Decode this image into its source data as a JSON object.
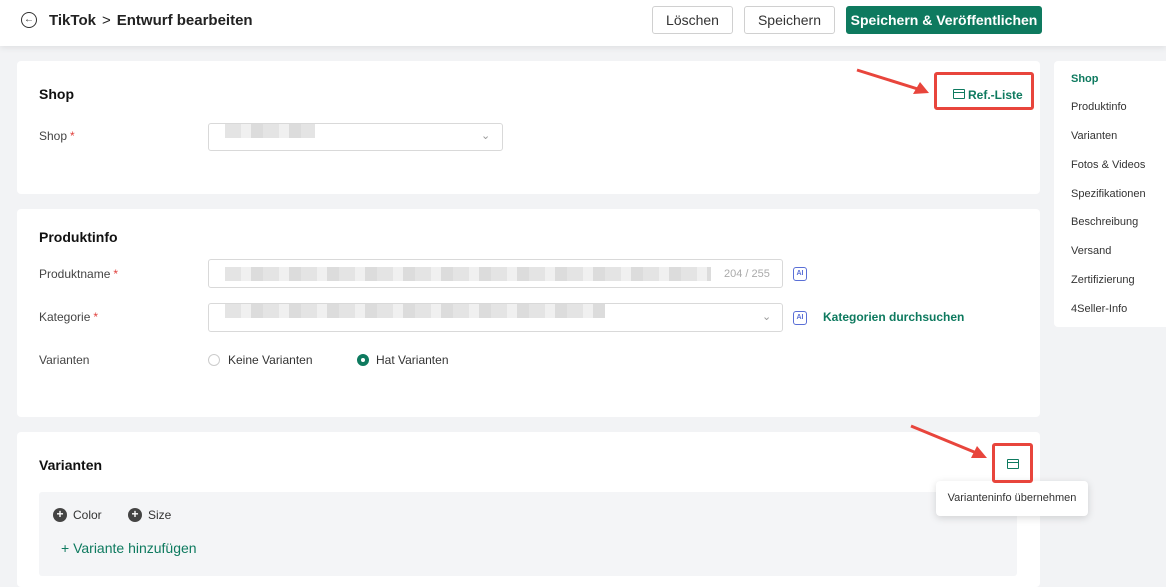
{
  "header": {
    "back_icon": "arrow-left-circle-icon",
    "crumb_root": "TikTok",
    "crumb_sep": ">",
    "crumb_current": "Entwurf bearbeiten",
    "delete_label": "Löschen",
    "save_label": "Speichern",
    "publish_label": "Speichern & Veröffentlichen"
  },
  "shop_section": {
    "title": "Shop",
    "ref_list_label": "Ref.-Liste",
    "shop_label": "Shop",
    "required_mark": "*"
  },
  "product_section": {
    "title": "Produktinfo",
    "name_label": "Produktname",
    "name_counter": "204 / 255",
    "category_label": "Kategorie",
    "search_categories_label": "Kategorien durchsuchen",
    "variants_label": "Varianten",
    "ai_badge": "AI",
    "no_variants_label": "Keine Varianten",
    "has_variants_label": "Hat Varianten",
    "selected_variant_option": "Hat Varianten"
  },
  "variants_section": {
    "title": "Varianten",
    "attr_color": "Color",
    "attr_size": "Size",
    "add_variant_label": "Variante hinzufügen",
    "tooltip": "Varianteninfo übernehmen"
  },
  "sidenav": {
    "items": [
      "Shop",
      "Produktinfo",
      "Varianten",
      "Fotos & Videos",
      "Spezifikationen",
      "Beschreibung",
      "Versand",
      "Zertifizierung",
      "4Seller-Info"
    ],
    "active": "Shop"
  },
  "colors": {
    "accent": "#0e7a5f",
    "annotation": "#e8453c"
  }
}
